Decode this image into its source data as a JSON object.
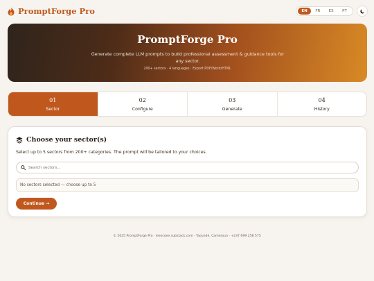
{
  "header": {
    "brand": "PromptForge Pro",
    "languages": [
      {
        "code": "EN",
        "active": true
      },
      {
        "code": "FR",
        "active": false
      },
      {
        "code": "ES",
        "active": false
      },
      {
        "code": "PT",
        "active": false
      }
    ]
  },
  "hero": {
    "title": "PromptForge Pro",
    "description": "Generate complete LLM prompts to build professional assessment & guidance tools for any sector.",
    "meta": "200+ sectors · 4 languages · Export PDF/Word/HTML"
  },
  "steps": [
    {
      "num": "01",
      "label": "Sector",
      "active": true
    },
    {
      "num": "02",
      "label": "Configure",
      "active": false
    },
    {
      "num": "03",
      "label": "Generate",
      "active": false
    },
    {
      "num": "04",
      "label": "History",
      "active": false
    }
  ],
  "card": {
    "title": "Choose your sector(s)",
    "subtitle": "Select up to 5 sectors from 200+ categories. The prompt will be tailored to your choices.",
    "search_placeholder": "Search sectors...",
    "selected_empty": "No sectors selected — choose up to 5",
    "continue_label": "Continue →"
  },
  "footer": {
    "text": "© 2025 PromptForge Pro · lesecoen.substack.com · Yaoundé, Cameroun · +237 699 258 575"
  },
  "colors": {
    "accent": "#c0581e",
    "background": "#f7f4ef"
  }
}
